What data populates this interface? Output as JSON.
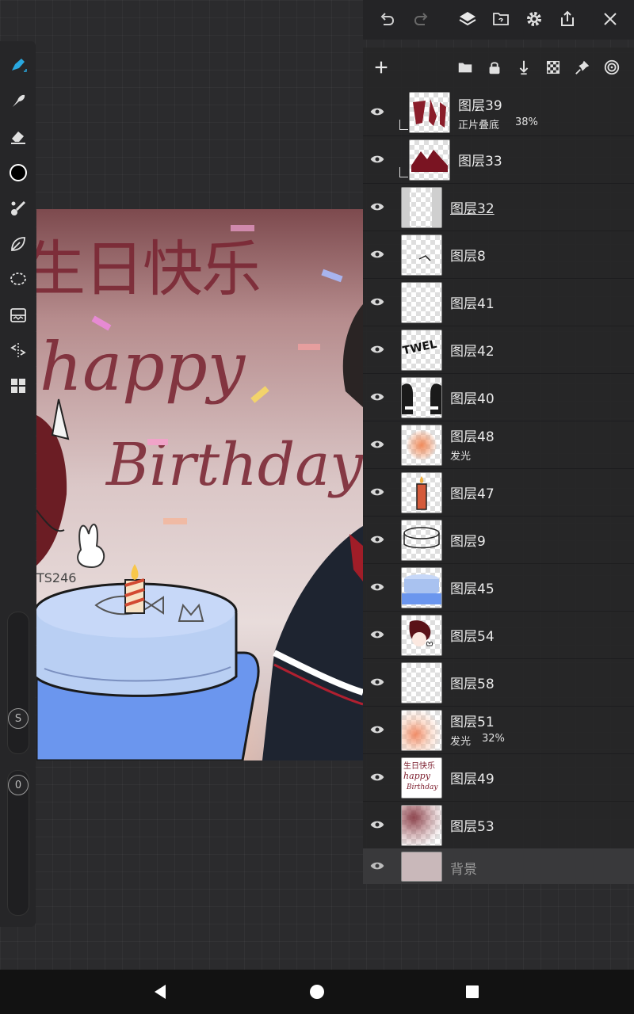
{
  "top_bar": {
    "icons": [
      "undo-icon",
      "redo-icon",
      "layers-icon",
      "reference-icon",
      "settings-icon",
      "export-icon",
      "close-icon"
    ]
  },
  "toolbar": {
    "tools": [
      "brush-icon",
      "smudge-icon",
      "eraser-icon",
      "color-icon",
      "blend-icon",
      "liquify-icon",
      "lasso-icon",
      "adjust-icon",
      "symmetry-icon",
      "gallery-icon"
    ],
    "size_label": "S",
    "opacity_label": "0"
  },
  "canvas": {
    "line1": "生日快乐",
    "line2": "happy",
    "line3": "Birthday",
    "signature": "TS246"
  },
  "layers_panel": {
    "header_icons": [
      "add-layer-icon",
      "group-icon",
      "lock-icon",
      "merge-down-icon",
      "alpha-lock-icon",
      "pin-icon",
      "settings-ring-icon"
    ],
    "layers": [
      {
        "name": "图层39",
        "mode": "正片叠底",
        "opacity": "38%",
        "clipped": true
      },
      {
        "name": "图层33",
        "mode": "",
        "opacity": "",
        "clipped": true
      },
      {
        "name": "图层32",
        "mode": "",
        "opacity": "",
        "clipped": false,
        "selected": true
      },
      {
        "name": "图层8",
        "mode": "",
        "opacity": "",
        "clipped": false
      },
      {
        "name": "图层41",
        "mode": "",
        "opacity": "",
        "clipped": false
      },
      {
        "name": "图层42",
        "mode": "",
        "opacity": "",
        "clipped": false
      },
      {
        "name": "图层40",
        "mode": "",
        "opacity": "",
        "clipped": false
      },
      {
        "name": "图层48",
        "mode": "发光",
        "opacity": "",
        "clipped": false
      },
      {
        "name": "图层47",
        "mode": "",
        "opacity": "",
        "clipped": false
      },
      {
        "name": "图层9",
        "mode": "",
        "opacity": "",
        "clipped": false
      },
      {
        "name": "图层45",
        "mode": "",
        "opacity": "",
        "clipped": false
      },
      {
        "name": "图层54",
        "mode": "",
        "opacity": "",
        "clipped": false
      },
      {
        "name": "图层58",
        "mode": "",
        "opacity": "",
        "clipped": false
      },
      {
        "name": "图层51",
        "mode": "发光",
        "opacity": "32%",
        "clipped": false
      },
      {
        "name": "图层49",
        "mode": "",
        "opacity": "",
        "clipped": false
      },
      {
        "name": "图层53",
        "mode": "",
        "opacity": "",
        "clipped": false
      }
    ],
    "background_label": "背景",
    "thumb_texts": {
      "layer42": "TWEL",
      "layer49_1": "生日快乐",
      "layer49_2": "happy",
      "layer49_3": "Birthday"
    }
  },
  "colors": {
    "accent": "#29a8e0",
    "panel": "#262628",
    "background": "#2b2b2d"
  }
}
